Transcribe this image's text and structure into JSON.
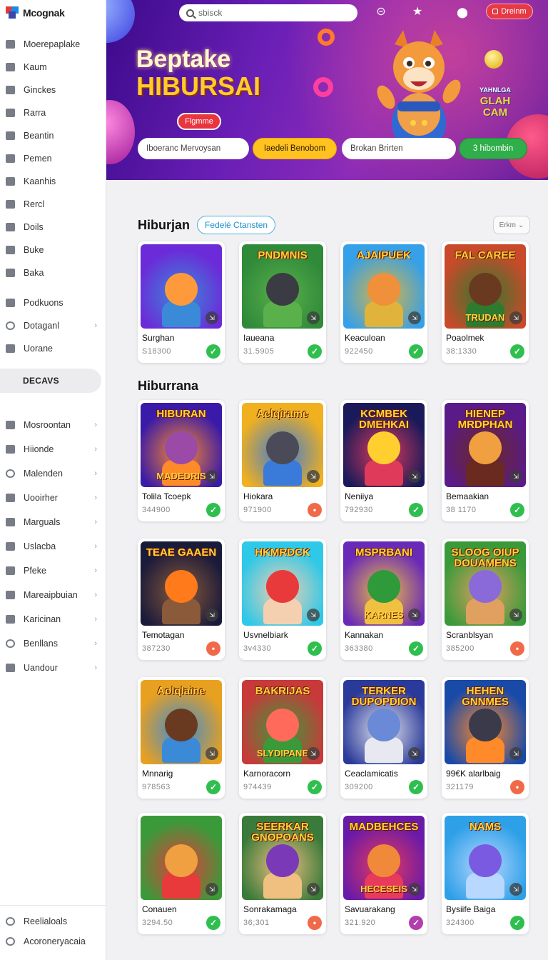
{
  "brand": {
    "name": "Mcognak"
  },
  "colors": {
    "accent": "#1b8fc9",
    "ok": "#2fbf4f",
    "warn": "#f06a4a",
    "purple": "#b23fae",
    "hero": "#5a1a9c"
  },
  "sidebar": {
    "items": [
      {
        "label": "Moerepaplake",
        "icon": "tag-icon"
      },
      {
        "label": "Kaum",
        "icon": "home-icon"
      },
      {
        "label": "Ginckes",
        "icon": "ticket-icon"
      },
      {
        "label": "Rarra",
        "icon": "picture-icon"
      },
      {
        "label": "Beantin",
        "icon": "chart-icon"
      },
      {
        "label": "Pemen",
        "icon": "shield-icon"
      },
      {
        "label": "Kaanhis",
        "icon": "bag-icon"
      },
      {
        "label": "Rercl",
        "icon": "grid-icon"
      },
      {
        "label": "Doils",
        "icon": "chat-icon"
      },
      {
        "label": "Buke",
        "icon": "book-icon"
      },
      {
        "label": "Baka",
        "icon": "box-icon"
      }
    ],
    "items2": [
      {
        "label": "Podkuons",
        "icon": "gift-icon"
      },
      {
        "label": "Dotaganl",
        "icon": "globe-icon",
        "chevron": true
      },
      {
        "label": "Uorane",
        "icon": "lock-icon"
      }
    ],
    "section": "DECAVS",
    "items3": [
      {
        "label": "Mosroontan",
        "icon": "chart-icon"
      },
      {
        "label": "Hiionde",
        "icon": "flag-icon"
      },
      {
        "label": "Malenden",
        "icon": "clock-icon"
      },
      {
        "label": "Uooirher",
        "icon": "calendar-icon"
      },
      {
        "label": "Marguals",
        "icon": "camera-icon"
      },
      {
        "label": "Uslacba",
        "icon": "table-icon"
      },
      {
        "label": "Pfeke",
        "icon": "mail-icon"
      },
      {
        "label": "Mareaipbuian",
        "icon": "card-icon"
      },
      {
        "label": "Karicinan",
        "icon": "folder-icon"
      },
      {
        "label": "Benllans",
        "icon": "pin-icon"
      },
      {
        "label": "Uandour",
        "icon": "cloud-icon"
      }
    ],
    "bottom": [
      {
        "label": "Reelialoals",
        "icon": "settings-icon"
      },
      {
        "label": "Acoroneryacaia",
        "icon": "help-icon"
      }
    ]
  },
  "hero": {
    "search_placeholder": "sbisck",
    "title_line1": "Beptake",
    "title_line2": "HIBURSAI",
    "pill": "Flgmme",
    "side_top": "YAHNLGA",
    "side_main": "GLAH CAM",
    "top_button": "Dreinm",
    "input1": "Iboeranc Mervoysan",
    "button1": "Iaedeli Benobom",
    "input2": "Brokan Brirten",
    "button2": "3  hibombin"
  },
  "section1": {
    "title": "Hiburjan",
    "chip": "Fedelé Ctansten",
    "filter": "Erkm"
  },
  "section2": {
    "title": "Hiburrana"
  },
  "cards": [
    {
      "name": "Surghan",
      "num": "S18300",
      "status": "ok",
      "art": "",
      "sub": ""
    },
    {
      "name": "Iaueana",
      "num": "31.5905",
      "status": "ok",
      "art": "PNDMNIS",
      "sub": ""
    },
    {
      "name": "Keaculoan",
      "num": "922450",
      "status": "ok",
      "art": "AJAIPUEK",
      "sub": ""
    },
    {
      "name": "Poaolmek",
      "num": "38:1330",
      "status": "ok",
      "art": "FAL CAREE",
      "sub": "TRUDAN"
    },
    {
      "name": "Tolila Tcoepk",
      "num": "344900",
      "status": "ok",
      "art": "HIBURAN",
      "sub": "MADEDRIS"
    },
    {
      "name": "Hiokara",
      "num": "971900",
      "status": "warn",
      "art": "Aclqirame",
      "sub": ""
    },
    {
      "name": "Neniiya",
      "num": "792930",
      "status": "ok",
      "art": "KCMBEK DMEHKAI",
      "sub": ""
    },
    {
      "name": "Bemaakian",
      "num": "38 1170",
      "status": "ok",
      "art": "HIENEP MRDPHAN",
      "sub": ""
    },
    {
      "name": "Temotagan",
      "num": "387230",
      "status": "warn",
      "art": "TEAE GAAEN",
      "sub": ""
    },
    {
      "name": "Usvnelbiark",
      "num": "3v4330",
      "status": "ok",
      "art": "HKMRDCK",
      "sub": ""
    },
    {
      "name": "Kannakan",
      "num": "363380",
      "status": "ok",
      "art": "MSPRBANI",
      "sub": "KARNES"
    },
    {
      "name": "Scranblsyan",
      "num": "385200",
      "status": "warn",
      "art": "SLOOG OIUP DOUAMENS",
      "sub": ""
    },
    {
      "name": "Mnnarig",
      "num": "978563",
      "status": "ok",
      "art": "Aolqlaine",
      "sub": ""
    },
    {
      "name": "Karnoracorn",
      "num": "974439",
      "status": "ok",
      "art": "BAKRIJAS",
      "sub": "SLYDIPANE"
    },
    {
      "name": "Ceaclamicatis",
      "num": "309200",
      "status": "ok",
      "art": "TERKER DUPOPDION",
      "sub": ""
    },
    {
      "name": "99€K alarlbaig",
      "num": "321179",
      "status": "warn",
      "art": "HEHEN GNNMES",
      "sub": ""
    },
    {
      "name": "Conauen",
      "num": "3294.50",
      "status": "ok",
      "art": "",
      "sub": ""
    },
    {
      "name": "Sonrakamaga",
      "num": "36;301",
      "status": "warn",
      "art": "SEERKAR GNOPOANS",
      "sub": ""
    },
    {
      "name": "Savuarakang",
      "num": "321.920",
      "status": "purple",
      "art": "MADBEHCES",
      "sub": "HECESEIS"
    },
    {
      "name": "Bysiife Baiga",
      "num": "324300",
      "status": "ok",
      "art": "NAMS",
      "sub": ""
    }
  ]
}
